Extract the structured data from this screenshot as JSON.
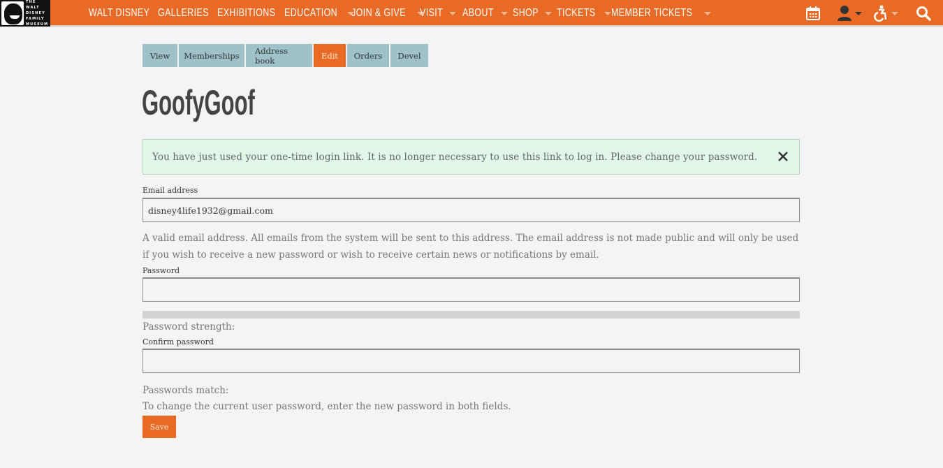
{
  "brand": {
    "logo_text": [
      "THE WALT",
      "DISNEY",
      "FAMILY",
      "MUSEUM"
    ],
    "accent_color": "#e86a24",
    "tab_color": "#9fc2c9"
  },
  "nav": {
    "items": [
      {
        "label": "WALT DISNEY",
        "has_dropdown": false
      },
      {
        "label": "GALLERIES",
        "has_dropdown": false
      },
      {
        "label": "EXHIBITIONS",
        "has_dropdown": false
      },
      {
        "label": "EDUCATION",
        "has_dropdown": true
      },
      {
        "label": "JOIN & GIVE",
        "has_dropdown": true
      },
      {
        "label": "VISIT",
        "has_dropdown": true
      },
      {
        "label": "ABOUT",
        "has_dropdown": true
      },
      {
        "label": "SHOP",
        "has_dropdown": true
      },
      {
        "label": "TICKETS",
        "has_dropdown": true
      },
      {
        "label": "MEMBER TICKETS",
        "has_dropdown": true
      }
    ],
    "icons": [
      "calendar-icon",
      "user-icon",
      "accessibility-icon",
      "search-icon"
    ]
  },
  "tabs": [
    {
      "label": "View",
      "active": false
    },
    {
      "label": "Memberships",
      "active": false
    },
    {
      "label": "Address book",
      "active": false
    },
    {
      "label": "Edit",
      "active": true
    },
    {
      "label": "Orders",
      "active": false
    },
    {
      "label": "Devel",
      "active": false
    }
  ],
  "page": {
    "title": "GoofyGoof"
  },
  "alert": {
    "message": "You have just used your one-time login link. It is no longer necessary to use this link to log in. Please change your password."
  },
  "form": {
    "email": {
      "label": "Email address",
      "value": "disney4life1932@gmail.com",
      "description": "A valid email address. All emails from the system will be sent to this address. The email address is not made public and will only be used if you wish to receive a new password or wish to receive certain news or notifications by email."
    },
    "password": {
      "label": "Password",
      "value": "",
      "strength_label": "Password strength:",
      "strength_fraction": 0
    },
    "confirm_password": {
      "label": "Confirm password",
      "value": "",
      "match_label": "Passwords match:",
      "description": "To change the current user password, enter the new password in both fields."
    },
    "save_label": "Save"
  }
}
